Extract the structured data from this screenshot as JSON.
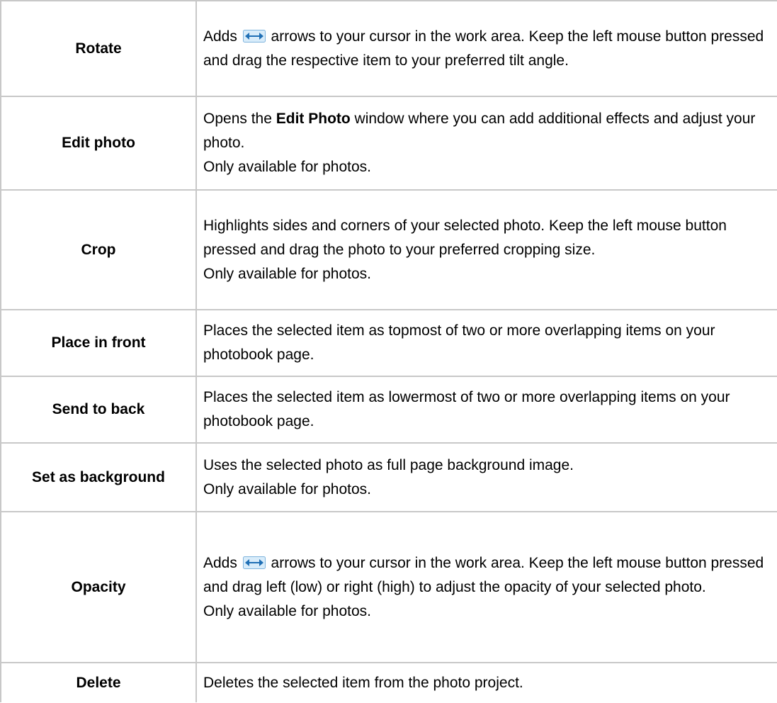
{
  "rows": [
    {
      "term": "Rotate",
      "desc_pre": "Adds ",
      "desc_icon": "horizontal-double-arrow-icon",
      "desc_post": " arrows to your cursor in the work area. Keep the left mouse button pressed and drag the respective item to your preferred tilt angle."
    },
    {
      "term": "Edit photo",
      "desc_pre": "Opens the ",
      "desc_bold": "Edit Photo",
      "desc_post": " window where you can add additional effects and adjust your photo.",
      "note": "Only available for photos."
    },
    {
      "term": "Crop",
      "desc": "Highlights sides and corners of your selected photo. Keep the left mouse button pressed and drag the photo to your preferred cropping size.",
      "note": "Only available for photos."
    },
    {
      "term": "Place in front",
      "desc": "Places the selected item as topmost of two or more overlapping items on your photobook page."
    },
    {
      "term": "Send to back",
      "desc": "Places the selected item as lowermost of two or more overlapping items on your photobook page."
    },
    {
      "term": "Set as background",
      "desc": "Uses the selected photo as full page background image.",
      "note": "Only available for photos."
    },
    {
      "term": "Opacity",
      "desc_pre": "Adds ",
      "desc_icon": "horizontal-double-arrow-icon",
      "desc_post": " arrows to your cursor in the work area. Keep the left mouse button pressed and drag left (low) or right (high) to adjust the opacity of your selected photo.",
      "note": "Only available for photos."
    },
    {
      "term": "Delete",
      "desc": "Deletes the selected item from the photo project."
    }
  ],
  "colors": {
    "border": "#c8c8c8",
    "arrow_fill": "#3a8fd0",
    "arrow_bg": "#d8ecfa"
  }
}
